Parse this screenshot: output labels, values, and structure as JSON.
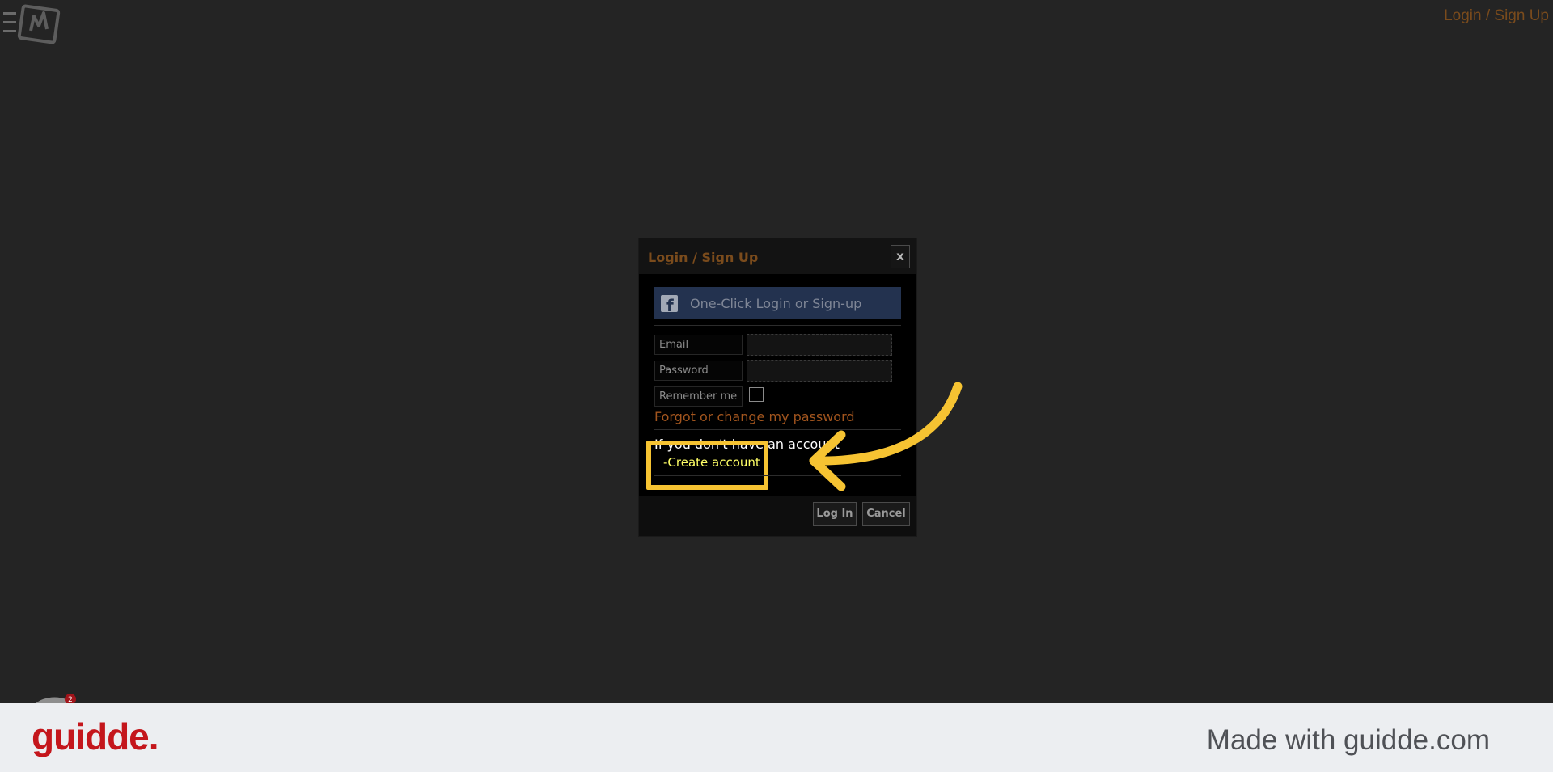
{
  "header": {
    "login_link": "Login / Sign Up"
  },
  "modal": {
    "title": "Login / Sign Up",
    "close_label": "x",
    "facebook_button": "One-Click Login or Sign-up",
    "email_label": "Email",
    "email_value": "",
    "password_label": "Password",
    "password_value": "",
    "remember_label": "Remember me",
    "forgot_link": "Forgot or change my password",
    "no_account_text": "If you don't have an account",
    "create_account_link": "-Create account",
    "login_button": "Log In",
    "cancel_button": "Cancel"
  },
  "notification": {
    "count": "2"
  },
  "footer": {
    "logo": "guidde.",
    "made_with": "Made with guidde.com"
  },
  "colors": {
    "background": "#242424",
    "accent_orange": "#7a4b1c",
    "facebook_blue": "#23324f",
    "highlight_yellow": "#f6c332",
    "guidde_red": "#c4161c"
  }
}
